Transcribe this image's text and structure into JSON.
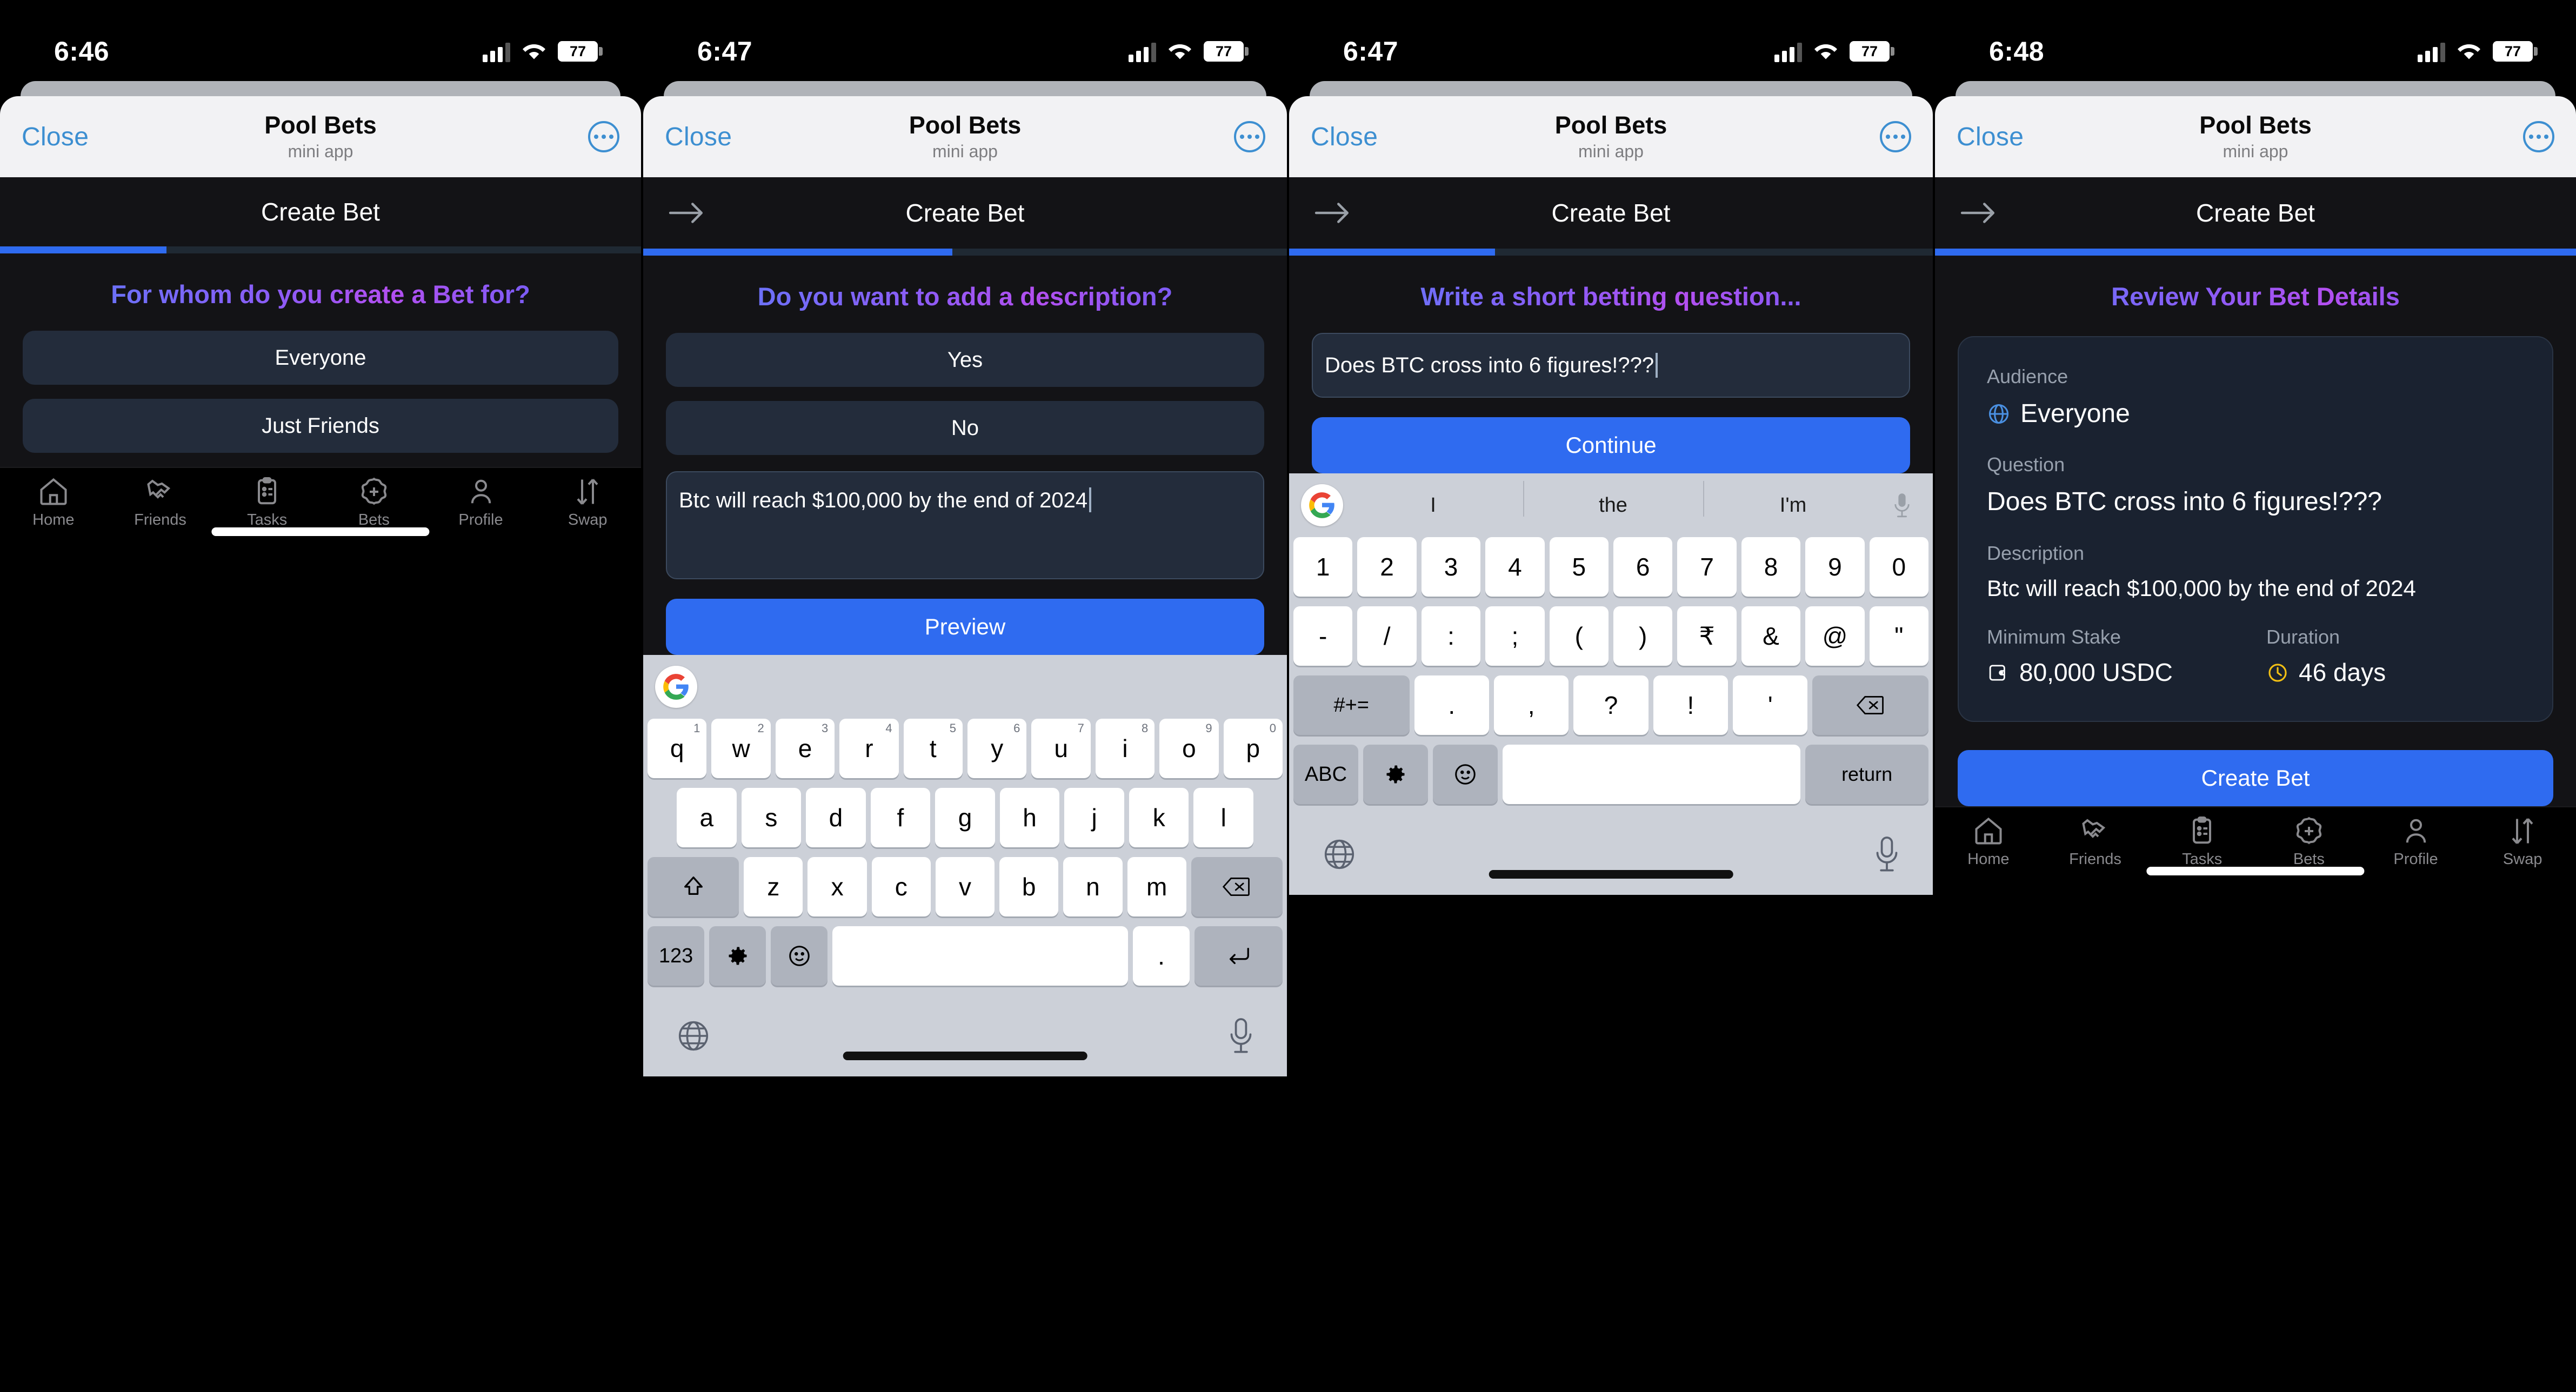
{
  "panels": [
    {
      "status": {
        "time": "6:46",
        "battery": "77"
      },
      "sheet": {
        "close_label": "Close",
        "title": "Pool Bets",
        "subtitle": "mini app",
        "more_icon": "ellipsis-icon"
      },
      "app_nav": {
        "title": "Create Bet",
        "has_back": false,
        "back_icon": "arrow-right-icon"
      },
      "progress_percent": 26,
      "heading": "For whom do you create a Bet for?",
      "options": [
        "Everyone",
        "Just Friends"
      ],
      "keyboard": null
    },
    {
      "status": {
        "time": "6:47",
        "battery": "77"
      },
      "sheet": {
        "close_label": "Close",
        "title": "Pool Bets",
        "subtitle": "mini app",
        "more_icon": "ellipsis-icon"
      },
      "app_nav": {
        "title": "Create Bet",
        "has_back": true,
        "back_icon": "arrow-right-icon"
      },
      "progress_percent": 48,
      "heading": "Do you want to add a description?",
      "options": [
        "Yes",
        "No"
      ],
      "description_value": "Btc will reach $100,000 by the end of 2024",
      "submit_label": "Preview",
      "keyboard": {
        "type": "letters",
        "logo": "google-g-icon",
        "suggestions": [],
        "row1": [
          {
            "key": "q",
            "hint": "1"
          },
          {
            "key": "w",
            "hint": "2"
          },
          {
            "key": "e",
            "hint": "3"
          },
          {
            "key": "r",
            "hint": "4"
          },
          {
            "key": "t",
            "hint": "5"
          },
          {
            "key": "y",
            "hint": "6"
          },
          {
            "key": "u",
            "hint": "7"
          },
          {
            "key": "i",
            "hint": "8"
          },
          {
            "key": "o",
            "hint": "9"
          },
          {
            "key": "p",
            "hint": "0"
          }
        ],
        "row2": [
          "a",
          "s",
          "d",
          "f",
          "g",
          "h",
          "j",
          "k",
          "l"
        ],
        "row3_keys": [
          "z",
          "x",
          "c",
          "v",
          "b",
          "n",
          "m"
        ],
        "shift_icon": "shift-arrow-icon",
        "backspace_icon": "backspace-icon",
        "row4": {
          "mode_label": "123",
          "settings_icon": "gear-icon",
          "emoji_icon": "emoji-icon",
          "space": "",
          "period": ".",
          "enter_icon": "enter-return-icon"
        },
        "globe_icon": "globe-icon",
        "mic_icon": "microphone-icon"
      }
    },
    {
      "status": {
        "time": "6:47",
        "battery": "77"
      },
      "sheet": {
        "close_label": "Close",
        "title": "Pool Bets",
        "subtitle": "mini app",
        "more_icon": "ellipsis-icon"
      },
      "app_nav": {
        "title": "Create Bet",
        "has_back": true,
        "back_icon": "arrow-right-icon"
      },
      "progress_percent": 32,
      "heading": "Write a short betting question...",
      "question_value": "Does BTC cross into 6 figures!???",
      "submit_label": "Continue",
      "keyboard": {
        "type": "symbols",
        "logo": "google-g-icon",
        "suggestions": [
          "I",
          "the",
          "I'm"
        ],
        "row1": [
          {
            "key": "1",
            "hint": ""
          },
          {
            "key": "2",
            "hint": ""
          },
          {
            "key": "3",
            "hint": ""
          },
          {
            "key": "4",
            "hint": ""
          },
          {
            "key": "5",
            "hint": ""
          },
          {
            "key": "6",
            "hint": ""
          },
          {
            "key": "7",
            "hint": ""
          },
          {
            "key": "8",
            "hint": ""
          },
          {
            "key": "9",
            "hint": ""
          },
          {
            "key": "0",
            "hint": ""
          }
        ],
        "row2": [
          "-",
          "/",
          ":",
          ";",
          "(",
          ")",
          "₹",
          "&",
          "@",
          "\""
        ],
        "row3_mode": "#+=",
        "row3_keys": [
          ".",
          ",",
          "?",
          "!",
          "'"
        ],
        "backspace_icon": "backspace-icon",
        "row4": {
          "mode_label": "ABC",
          "settings_icon": "gear-icon",
          "emoji_icon": "emoji-icon",
          "space": "",
          "return_label": "return"
        },
        "globe_icon": "globe-icon",
        "mic_icon": "microphone-icon"
      }
    },
    {
      "status": {
        "time": "6:48",
        "battery": "77"
      },
      "sheet": {
        "close_label": "Close",
        "title": "Pool Bets",
        "subtitle": "mini app",
        "more_icon": "ellipsis-icon"
      },
      "app_nav": {
        "title": "Create Bet",
        "has_back": true,
        "back_icon": "arrow-right-icon"
      },
      "progress_percent": 100,
      "heading": "Review Your Bet Details",
      "review": {
        "audience_label": "Audience",
        "audience_value": "Everyone",
        "audience_icon": "globe-icon",
        "question_label": "Question",
        "question_value": "Does BTC cross into 6 figures!???",
        "description_label": "Description",
        "description_value": "Btc will reach $100,000 by the end of 2024",
        "stake_label": "Minimum Stake",
        "stake_value": "80,000 USDC",
        "stake_icon": "wallet-icon",
        "duration_label": "Duration",
        "duration_value": "46 days",
        "duration_icon": "clock-icon"
      },
      "submit_label": "Create Bet",
      "keyboard": null
    }
  ],
  "tabbar": {
    "items": [
      {
        "label": "Home",
        "icon": "home-icon"
      },
      {
        "label": "Friends",
        "icon": "handshake-icon"
      },
      {
        "label": "Tasks",
        "icon": "clipboard-icon"
      },
      {
        "label": "Bets",
        "icon": "badge-plus-icon"
      },
      {
        "label": "Profile",
        "icon": "person-icon"
      },
      {
        "label": "Swap",
        "icon": "swap-arrows-icon"
      }
    ]
  },
  "colors": {
    "accent_blue": "#2f6bf0",
    "heading_gradient_start": "#5b7cfa",
    "heading_gradient_end": "#b34ff0",
    "card_bg": "#1a2230",
    "app_bg": "#131316",
    "option_bg": "#232c3b",
    "sheet_bg": "#f2f2f4",
    "close_link": "#3d8fd1",
    "duration_icon_color": "#f2c014"
  }
}
